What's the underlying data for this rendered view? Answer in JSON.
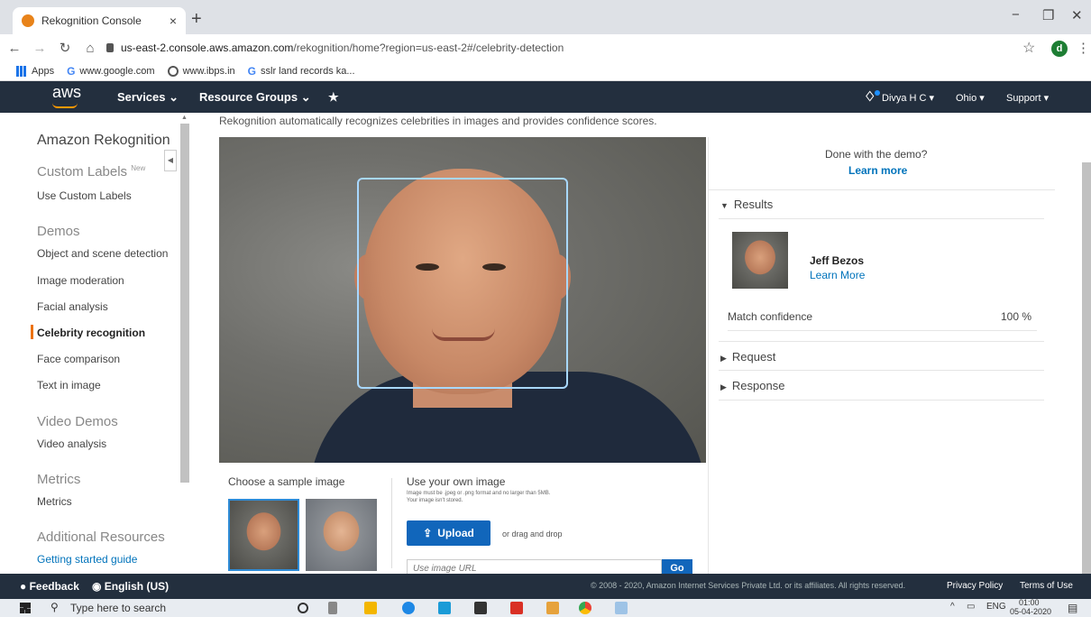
{
  "browser": {
    "tab_title": "Rekognition Console",
    "tab_close": "×",
    "new_tab": "+",
    "url_host": "us-east-2.console.aws.amazon.com",
    "url_path": "/rekognition/home?region=us-east-2#/celebrity-detection",
    "profile_initial": "d",
    "bookmarks": [
      "Apps",
      "www.google.com",
      "www.ibps.in",
      "sslr land records ka..."
    ]
  },
  "aws_header": {
    "logo": "aws",
    "services": "Services ⌄",
    "resource_groups": "Resource Groups ⌄",
    "pin": "★",
    "user": "Divya H C ▾",
    "region": "Ohio ▾",
    "support": "Support ▾"
  },
  "sidebar": {
    "title": "Amazon Rekognition",
    "custom_labels": "Custom Labels",
    "custom_labels_badge": "New",
    "use_custom_labels": "Use Custom Labels",
    "demos": "Demos",
    "demo_items": [
      "Object and scene detection",
      "Image moderation",
      "Facial analysis",
      "Celebrity recognition",
      "Face comparison",
      "Text in image"
    ],
    "video_demos": "Video Demos",
    "video_analysis": "Video analysis",
    "metrics_header": "Metrics",
    "metrics_item": "Metrics",
    "additional_resources": "Additional Resources",
    "getting_started": "Getting started guide",
    "active_item": "Celebrity recognition"
  },
  "main": {
    "description": "Rekognition automatically recognizes celebrities in images and provides confidence scores.",
    "choose_sample": "Choose a sample image",
    "use_own": "Use your own image",
    "own_hint": "Image must be .jpeg or .png format and no larger than 5MB. Your image isn't stored.",
    "upload": "Upload",
    "drag_drop": "or drag and drop",
    "url_placeholder": "Use image URL",
    "go": "Go"
  },
  "results": {
    "done_question": "Done with the demo?",
    "learn_more_top": "Learn more",
    "results_header": "Results",
    "celebrity_name": "Jeff Bezos",
    "celebrity_link": "Learn More",
    "match_label": "Match confidence",
    "match_value": "100 %",
    "request_header": "Request",
    "response_header": "Response"
  },
  "footer": {
    "feedback": "Feedback",
    "language": "English (US)",
    "copyright": "© 2008 - 2020, Amazon Internet Services Private Ltd. or its affiliates. All rights reserved.",
    "privacy": "Privacy Policy",
    "terms": "Terms of Use"
  },
  "taskbar": {
    "search": "Type here to search",
    "lang": "ENG",
    "time": "01:00",
    "date": "05-04-2020"
  },
  "colors": {
    "aws_dark": "#232f3e",
    "aws_orange": "#ff9900",
    "link_blue": "#0073bb",
    "button_blue": "#1166bb",
    "active_marker": "#ec7211"
  }
}
